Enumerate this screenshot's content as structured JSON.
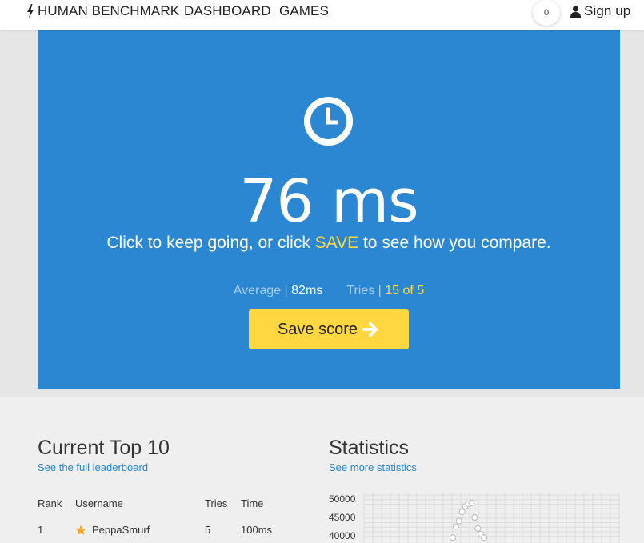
{
  "nav": {
    "brand": "HUMAN BENCHMARK",
    "dashboard": "DASHBOARD",
    "games": "GAMES",
    "notification_count": "0",
    "signup": "Sign up"
  },
  "hero": {
    "result": "76 ms",
    "message_prefix": "Click to keep going, or click ",
    "message_highlight": "SAVE",
    "message_suffix": " to see how you compare.",
    "average_label": "Average",
    "average_sep": " | ",
    "average_value": "82ms",
    "tries_label": "Tries",
    "tries_sep": " | ",
    "tries_value": "15 of 5",
    "save_button": "Save score"
  },
  "leaderboard": {
    "title": "Current Top 10",
    "link": "See the full leaderboard",
    "headers": [
      "Rank",
      "Username",
      "Tries",
      "Time"
    ],
    "rows": [
      {
        "rank": "1",
        "username": "PeppaSmurf",
        "tries": "5",
        "time": "100ms"
      }
    ]
  },
  "statistics": {
    "title": "Statistics",
    "link": "See more statistics"
  },
  "chart_data": {
    "type": "scatter",
    "y_ticks": [
      "50000",
      "45000",
      "40000"
    ],
    "ylim": [
      40000,
      50000
    ],
    "grid": true,
    "points": [
      {
        "x": 1,
        "y": 39500
      },
      {
        "x": 2,
        "y": 42500
      },
      {
        "x": 3,
        "y": 44000
      },
      {
        "x": 4,
        "y": 46500
      },
      {
        "x": 5,
        "y": 48000
      },
      {
        "x": 6,
        "y": 48700
      },
      {
        "x": 7,
        "y": 48900
      },
      {
        "x": 8,
        "y": 45000
      },
      {
        "x": 9,
        "y": 42000
      },
      {
        "x": 10,
        "y": 40500
      },
      {
        "x": 11,
        "y": 39500
      }
    ]
  },
  "colors": {
    "hero_bg": "#2b87d1",
    "accent_yellow": "#ffd841",
    "link_blue": "#2b87d1",
    "star": "#f5a623"
  }
}
